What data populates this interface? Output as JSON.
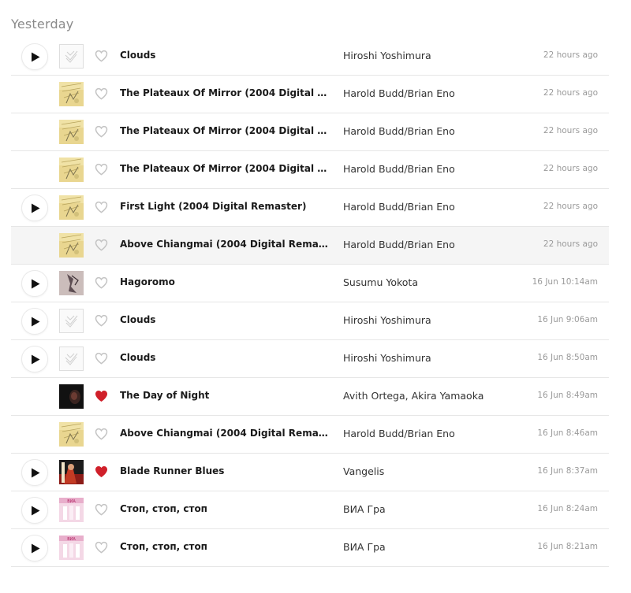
{
  "section": {
    "heading": "Yesterday"
  },
  "colors": {
    "heart_loved": "#d0202a",
    "heart_empty": "#c4c4c4",
    "play_icon": "#111111"
  },
  "tracks": [
    {
      "title": "Clouds",
      "artist": "Hiroshi Yoshimura",
      "time": "22 hours ago",
      "has_play": true,
      "loved": false,
      "art": "placeholder-art"
    },
    {
      "title": "The Plateaux Of Mirror (2004 Digital Rema...",
      "artist": "Harold Budd/Brian Eno",
      "time": "22 hours ago",
      "has_play": false,
      "loved": false,
      "art": "plateaux-art"
    },
    {
      "title": "The Plateaux Of Mirror (2004 Digital Rema...",
      "artist": "Harold Budd/Brian Eno",
      "time": "22 hours ago",
      "has_play": false,
      "loved": false,
      "art": "plateaux-art"
    },
    {
      "title": "The Plateaux Of Mirror (2004 Digital Rema...",
      "artist": "Harold Budd/Brian Eno",
      "time": "22 hours ago",
      "has_play": false,
      "loved": false,
      "art": "plateaux-art"
    },
    {
      "title": "First Light (2004 Digital Remaster)",
      "artist": "Harold Budd/Brian Eno",
      "time": "22 hours ago",
      "has_play": true,
      "loved": false,
      "art": "plateaux-art"
    },
    {
      "title": "Above Chiangmai (2004 Digital Remaster)",
      "artist": "Harold Budd/Brian Eno",
      "time": "22 hours ago",
      "has_play": false,
      "loved": false,
      "art": "plateaux-art",
      "highlighted": true
    },
    {
      "title": "Hagoromo",
      "artist": "Susumu Yokota",
      "time": "16 Jun 10:14am",
      "has_play": true,
      "loved": false,
      "art": "hagoromo-art"
    },
    {
      "title": "Clouds",
      "artist": "Hiroshi Yoshimura",
      "time": "16 Jun 9:06am",
      "has_play": true,
      "loved": false,
      "art": "placeholder-art"
    },
    {
      "title": "Clouds",
      "artist": "Hiroshi Yoshimura",
      "time": "16 Jun 8:50am",
      "has_play": true,
      "loved": false,
      "art": "placeholder-art"
    },
    {
      "title": "The Day of Night",
      "artist": "Avith Ortega, Akira Yamaoka",
      "time": "16 Jun 8:49am",
      "has_play": false,
      "loved": true,
      "art": "dark-art"
    },
    {
      "title": "Above Chiangmai (2004 Digital Remaster)",
      "artist": "Harold Budd/Brian Eno",
      "time": "16 Jun 8:46am",
      "has_play": false,
      "loved": false,
      "art": "plateaux-art"
    },
    {
      "title": "Blade Runner Blues",
      "artist": "Vangelis",
      "time": "16 Jun 8:37am",
      "has_play": true,
      "loved": true,
      "art": "bladerunner-art"
    },
    {
      "title": "Стоп, стоп, стоп",
      "artist": "ВИА Гра",
      "time": "16 Jun 8:24am",
      "has_play": true,
      "loved": false,
      "art": "viagra-art"
    },
    {
      "title": "Стоп, стоп, стоп",
      "artist": "ВИА Гра",
      "time": "16 Jun 8:21am",
      "has_play": true,
      "loved": false,
      "art": "viagra-art"
    }
  ]
}
